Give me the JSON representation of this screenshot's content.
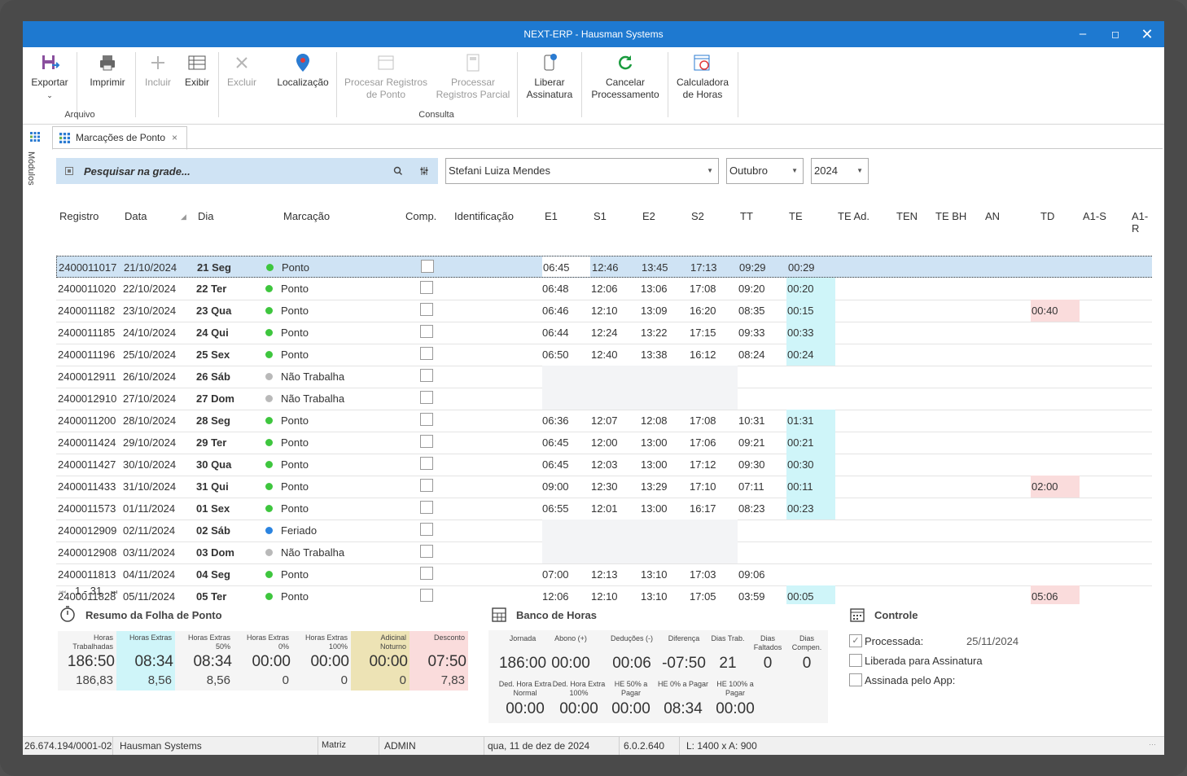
{
  "window": {
    "title": "NEXT-ERP - Hausman Systems"
  },
  "ribbon": {
    "buttons": [
      {
        "label": "Exportar",
        "icon": "export-icon"
      },
      {
        "label": "Imprimir",
        "icon": "printer-icon"
      },
      {
        "label": "Incluir",
        "icon": "plus-icon"
      },
      {
        "label": "Exibir",
        "icon": "view-grid-icon"
      },
      {
        "label": "Excluir",
        "icon": "x-icon"
      },
      {
        "label": "Localização",
        "icon": "map-pin-icon"
      },
      {
        "label": "Procesar Registros de Ponto",
        "icon": "calendar-icon"
      },
      {
        "label": "Processar Registros Parcial",
        "icon": "calculator-icon"
      },
      {
        "label": "Liberar Assinatura",
        "icon": "phone-icon"
      },
      {
        "label": "Cancelar Processamento",
        "icon": "refresh-icon"
      },
      {
        "label": "Calculadora de Horas",
        "icon": "clock-calculator-icon"
      }
    ],
    "groups": [
      "Arquivo",
      "Consulta"
    ]
  },
  "tabs": {
    "modulos": "Módulos",
    "active": "Marcações de Ponto"
  },
  "filters": {
    "search_placeholder": "Pesquisar na grade...",
    "employee": "Stefani Luiza Mendes",
    "month": "Outubro",
    "year": "2024"
  },
  "grid": {
    "columns": [
      "Registro",
      "Data",
      "Dia",
      "Marcação",
      "Comp.",
      "Identificação",
      "E1",
      "S1",
      "E2",
      "S2",
      "TT",
      "TE",
      "TE Ad.",
      "TEN",
      "TE BH",
      "AN",
      "TD",
      "A1-S",
      "A1-R"
    ],
    "rows": [
      {
        "registro": "2400011017",
        "data": "21/10/2024",
        "dia": "21 Seg",
        "marcacao": "Ponto",
        "status": "green",
        "e1": "06:45",
        "s1": "12:46",
        "e2": "13:45",
        "s2": "17:13",
        "tt": "09:29",
        "te": "00:29",
        "td": ""
      },
      {
        "registro": "2400011020",
        "data": "22/10/2024",
        "dia": "22 Ter",
        "marcacao": "Ponto",
        "status": "green",
        "e1": "06:48",
        "s1": "12:06",
        "e2": "13:06",
        "s2": "17:08",
        "tt": "09:20",
        "te": "00:20",
        "td": ""
      },
      {
        "registro": "2400011182",
        "data": "23/10/2024",
        "dia": "23 Qua",
        "marcacao": "Ponto",
        "status": "green",
        "e1": "06:46",
        "s1": "12:10",
        "e2": "13:09",
        "s2": "16:20",
        "tt": "08:35",
        "te": "00:15",
        "td": "00:40"
      },
      {
        "registro": "2400011185",
        "data": "24/10/2024",
        "dia": "24 Qui",
        "marcacao": "Ponto",
        "status": "green",
        "e1": "06:44",
        "s1": "12:24",
        "e2": "13:22",
        "s2": "17:15",
        "tt": "09:33",
        "te": "00:33",
        "td": ""
      },
      {
        "registro": "2400011196",
        "data": "25/10/2024",
        "dia": "25 Sex",
        "marcacao": "Ponto",
        "status": "green",
        "e1": "06:50",
        "s1": "12:40",
        "e2": "13:38",
        "s2": "16:12",
        "tt": "08:24",
        "te": "00:24",
        "td": ""
      },
      {
        "registro": "2400012911",
        "data": "26/10/2024",
        "dia": "26 Sáb",
        "marcacao": "Não Trabalha",
        "status": "grey",
        "e1": "",
        "s1": "",
        "e2": "",
        "s2": "",
        "tt": "",
        "te": "",
        "td": ""
      },
      {
        "registro": "2400012910",
        "data": "27/10/2024",
        "dia": "27 Dom",
        "marcacao": "Não Trabalha",
        "status": "grey",
        "e1": "",
        "s1": "",
        "e2": "",
        "s2": "",
        "tt": "",
        "te": "",
        "td": ""
      },
      {
        "registro": "2400011200",
        "data": "28/10/2024",
        "dia": "28 Seg",
        "marcacao": "Ponto",
        "status": "green",
        "e1": "06:36",
        "s1": "12:07",
        "e2": "12:08",
        "s2": "17:08",
        "tt": "10:31",
        "te": "01:31",
        "td": ""
      },
      {
        "registro": "2400011424",
        "data": "29/10/2024",
        "dia": "29 Ter",
        "marcacao": "Ponto",
        "status": "green",
        "e1": "06:45",
        "s1": "12:00",
        "e2": "13:00",
        "s2": "17:06",
        "tt": "09:21",
        "te": "00:21",
        "td": ""
      },
      {
        "registro": "2400011427",
        "data": "30/10/2024",
        "dia": "30 Qua",
        "marcacao": "Ponto",
        "status": "green",
        "e1": "06:45",
        "s1": "12:03",
        "e2": "13:00",
        "s2": "17:12",
        "tt": "09:30",
        "te": "00:30",
        "td": ""
      },
      {
        "registro": "2400011433",
        "data": "31/10/2024",
        "dia": "31 Qui",
        "marcacao": "Ponto",
        "status": "green",
        "e1": "09:00",
        "s1": "12:30",
        "e2": "13:29",
        "s2": "17:10",
        "tt": "07:11",
        "te": "00:11",
        "td": "02:00"
      },
      {
        "registro": "2400011573",
        "data": "01/11/2024",
        "dia": "01 Sex",
        "marcacao": "Ponto",
        "status": "green",
        "e1": "06:55",
        "s1": "12:01",
        "e2": "13:00",
        "s2": "16:17",
        "tt": "08:23",
        "te": "00:23",
        "td": ""
      },
      {
        "registro": "2400012909",
        "data": "02/11/2024",
        "dia": "02 Sáb",
        "marcacao": "Feriado",
        "status": "blue",
        "e1": "",
        "s1": "",
        "e2": "",
        "s2": "",
        "tt": "",
        "te": "",
        "td": ""
      },
      {
        "registro": "2400012908",
        "data": "03/11/2024",
        "dia": "03 Dom",
        "marcacao": "Não Trabalha",
        "status": "grey",
        "e1": "",
        "s1": "",
        "e2": "",
        "s2": "",
        "tt": "",
        "te": "",
        "td": ""
      },
      {
        "registro": "2400011813",
        "data": "04/11/2024",
        "dia": "04 Seg",
        "marcacao": "Ponto",
        "status": "green",
        "e1": "07:00",
        "s1": "12:13",
        "e2": "13:10",
        "s2": "17:03",
        "tt": "09:06",
        "te": "",
        "td": ""
      },
      {
        "registro": "2400011828",
        "data": "05/11/2024",
        "dia": "05 Ter",
        "marcacao": "Ponto",
        "status": "green",
        "e1": "12:06",
        "s1": "12:10",
        "e2": "13:10",
        "s2": "17:05",
        "tt": "03:59",
        "te": "00:05",
        "td": "05:06"
      }
    ],
    "pager": "1 - 31"
  },
  "resumo": {
    "title": "Resumo da Folha de Ponto",
    "cards": [
      {
        "label": "Horas Trabalhadas",
        "big": "186:50",
        "small": "186,83",
        "bg": "#f5f5f5"
      },
      {
        "label": "Horas Extras",
        "big": "08:34",
        "small": "8,56",
        "bg": "#cff5f9"
      },
      {
        "label": "Horas Extras 50%",
        "big": "08:34",
        "small": "8,56",
        "bg": "#f5f5f5"
      },
      {
        "label": "Horas Extras 0%",
        "big": "00:00",
        "small": "0",
        "bg": "#f5f5f5"
      },
      {
        "label": "Horas Extras 100%",
        "big": "00:00",
        "small": "0",
        "bg": "#f5f5f5"
      },
      {
        "label": "Adicinal Noturno",
        "big": "00:00",
        "small": "0",
        "bg": "#ede3b5"
      },
      {
        "label": "Desconto",
        "big": "07:50",
        "small": "7,83",
        "bg": "#fadcdc"
      }
    ]
  },
  "banco": {
    "title": "Banco de Horas",
    "row1": [
      {
        "label": "Jornada",
        "value": "186:00"
      },
      {
        "label": "Abono (+)",
        "value": "00:00"
      },
      {
        "label": "Deduções (-)",
        "value": "00:06"
      },
      {
        "label": "Diferença",
        "value": "-07:50"
      },
      {
        "label": "Dias Trab.",
        "value": "21"
      },
      {
        "label": "Dias Faltados",
        "value": "0"
      },
      {
        "label": "Dias Compen.",
        "value": "0"
      }
    ],
    "row2": [
      {
        "label": "Ded. Hora Extra Normal",
        "value": "00:00"
      },
      {
        "label": "Ded. Hora Extra 100%",
        "value": "00:00"
      },
      {
        "label": "HE 50% a Pagar",
        "value": "00:00"
      },
      {
        "label": "HE 0% a Pagar",
        "value": "08:34"
      },
      {
        "label": "HE 100% a Pagar",
        "value": "00:00"
      }
    ]
  },
  "controle": {
    "title": "Controle",
    "processada_label": "Processada:",
    "processada_date": "25/11/2024",
    "liberada_label": "Liberada para Assinatura",
    "assinada_label": "Assinada pelo App:"
  },
  "status": {
    "cnpj": "26.674.194/0001-02",
    "company": "Hausman Systems",
    "branch": "Matriz",
    "user": "ADMIN",
    "date": "qua, 11 de dez de 2024",
    "version": "6.0.2.640",
    "resolution": "L: 1400 x A: 900"
  }
}
